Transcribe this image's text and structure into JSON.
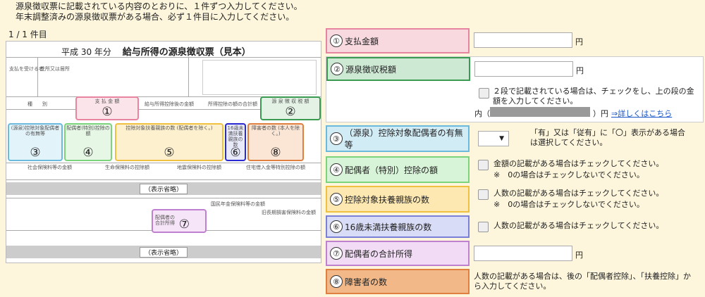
{
  "instructions": {
    "line1": "源泉徴収票に記載されている内容のとおりに、１件ずつ入力してください。",
    "line2": "年末調整済みの源泉徴収票がある場合、必ず１件目に入力してください。"
  },
  "record_count": "1 / 1 件目",
  "document": {
    "year": "平成 30 年分",
    "title": "給与所得の源泉徴収票（見本）",
    "omitted": "（表示省略）",
    "markers": {
      "m1": "①",
      "m2": "②",
      "m3": "③",
      "m4": "④",
      "m5": "⑤",
      "m6": "⑥",
      "m7": "⑦",
      "m8": "⑧"
    },
    "captions": {
      "m1": "支 払 金 額",
      "m2": "源 泉 徴 収 税 額",
      "m3": "(源泉)控除対象配偶者の有無等",
      "m4": "配偶者(特別)控除の額",
      "m5": "控除対象扶養親族の数 (配偶者を除く。)",
      "m6": "16歳未満扶養親族の数",
      "m8": "障害者の数 (本人を除く。)",
      "m7": "配偶者の合計所得"
    },
    "small_labels": {
      "shubetsu": "種　　別",
      "kyuyo": "給与所得控除後の金額",
      "kojo_total": "所得控除の額の合計額",
      "shakai": "社会保険料等の金額",
      "seimei": "生命保険料の控除額",
      "jishin": "地震保険料の控除額",
      "jutaku": "住宅借入金等特別控除の額",
      "shiharai": "支払を受ける者",
      "jusho": "住所又は居所",
      "kokumin": "国民年金保険料等の金額",
      "kyu_choki": "旧長期損害保険料の金額"
    }
  },
  "form": {
    "yen": "円",
    "rows": [
      {
        "num": "①",
        "label": "支払金額",
        "color": "#f7d9df",
        "border": "#e784a0"
      },
      {
        "num": "②",
        "label": "源泉徴収税額",
        "color": "#cde9d4",
        "border": "#3a9a50"
      },
      {
        "num": "③",
        "label": "（源泉）控除対象配偶者の有無等",
        "color": "#d2ecf6",
        "border": "#6bb9dd"
      },
      {
        "num": "④",
        "label": "配偶者（特別）控除の額",
        "color": "#d8f4d8",
        "border": "#7bd37b"
      },
      {
        "num": "⑤",
        "label": "控除対象扶養親族の数",
        "color": "#fde8b2",
        "border": "#f0c040"
      },
      {
        "num": "⑥",
        "label": "16歳未満扶養親族の数",
        "color": "#d8dcf7",
        "border": "#7a80d8"
      },
      {
        "num": "⑦",
        "label": "配偶者の合計所得",
        "color": "#f2dcf5",
        "border": "#c080d0"
      },
      {
        "num": "⑧",
        "label": "障害者の数",
        "color": "#f3b888",
        "border": "#e08040"
      }
    ],
    "row2_note": "２段で記載されている場合は、チェックをし、上の段の金額を入力してください。",
    "row2_uchi": "内（",
    "row2_close": "）円",
    "row2_link": "⇒詳しくはこちら",
    "row3_select": "▼",
    "row3_note": "「有」又は「従有」に「〇」表示がある場合は選択してください。",
    "row4_note1": "金額の記載がある場合はチェックしてください。",
    "row4_note2": "※　0の場合はチェックしないでください。",
    "row5_note1": "人数の記載がある場合はチェックしてください。",
    "row5_note2": "※　0の場合はチェックしないでください。",
    "row6_note": "人数の記載がある場合はチェックしてください。",
    "row8_note": "人数の記載がある場合は、後の「配偶者控除」、「扶養控除」から入力してください。"
  },
  "colors": {
    "background": "#fdf6dc",
    "link": "#1a56c8"
  }
}
